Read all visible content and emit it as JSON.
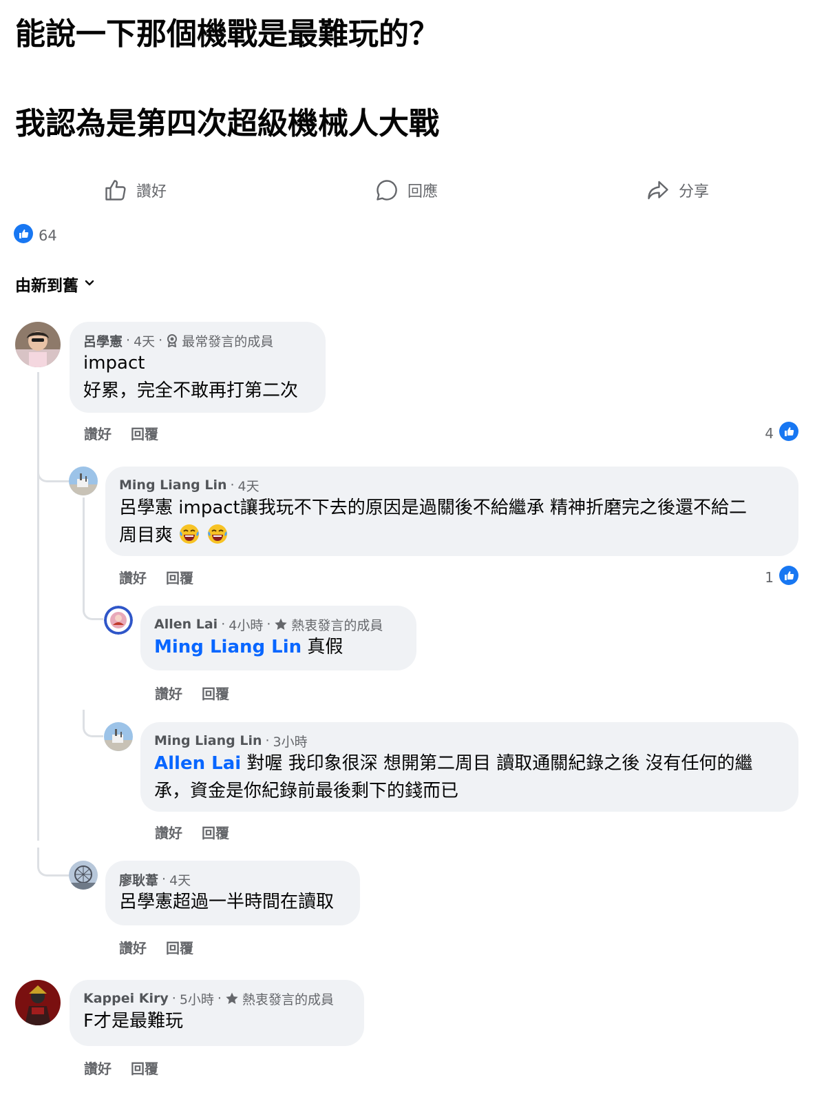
{
  "post": {
    "line1": "能說一下那個機戰是最難玩的？",
    "line2": "我認為是第四次超級機械人大戰"
  },
  "actions": {
    "like": "讚好",
    "comment": "回應",
    "share": "分享"
  },
  "reactions": {
    "count": "64"
  },
  "sort": {
    "label": "由新到舊"
  },
  "comments": [
    {
      "author": "呂學憲",
      "time": "4天",
      "badge": "最常發言的成員",
      "lines": [
        "impact",
        "好累，完全不敢再打第二次"
      ],
      "like_label": "讚好",
      "reply_label": "回覆",
      "likes": "4"
    },
    {
      "author": "Ming Liang Lin",
      "time": "4天",
      "text_line1": "呂學憲 impact讓我玩不下去的原因是過關後不給繼承 精神折磨完之後還不給二",
      "text_line2": "周目爽",
      "like_label": "讚好",
      "reply_label": "回覆",
      "likes": "1"
    },
    {
      "author": "Allen Lai",
      "time": "4小時",
      "badge": "熱衷發言的成員",
      "mention": "Ming Liang Lin",
      "text": " 真假",
      "like_label": "讚好",
      "reply_label": "回覆"
    },
    {
      "author": "Ming Liang Lin",
      "time": "3小時",
      "mention": "Allen Lai",
      "text_line1": " 對喔 我印象很深 想開第二周目 讀取通關紀錄之後 沒有任何的繼",
      "text_line2": "承，資金是你紀錄前最後剩下的錢而已",
      "like_label": "讚好",
      "reply_label": "回覆"
    },
    {
      "author": "廖耿葦",
      "time": "4天",
      "text": "呂學憲超過一半時間在讀取",
      "like_label": "讚好",
      "reply_label": "回覆"
    },
    {
      "author": "Kappei Kiry",
      "time": "5小時",
      "badge": "熱衷發言的成員",
      "text": "F才是最難玩",
      "like_label": "讚好",
      "reply_label": "回覆"
    }
  ],
  "colors": {
    "accent": "#0866ff",
    "bubble": "#f0f2f5",
    "secondary_text": "#65676b"
  }
}
